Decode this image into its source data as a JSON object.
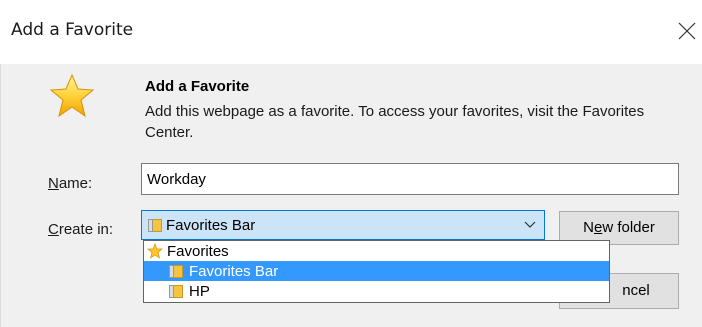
{
  "dialog": {
    "title": "Add a Favorite",
    "heading": "Add a Favorite",
    "description": "Add this webpage as a favorite. To access your favorites, visit the Favorites Center."
  },
  "form": {
    "name_label_u": "N",
    "name_label_rest": "ame:",
    "name_value": "Workday",
    "create_label_u": "C",
    "create_label_rest": "reate in:",
    "create_in_selected": "Favorites Bar"
  },
  "buttons": {
    "new_folder_pre": "N",
    "new_folder_u": "e",
    "new_folder_rest": "w folder",
    "cancel_partial": "ncel"
  },
  "dropdown": {
    "items": [
      {
        "label": "Favorites",
        "icon": "star-icon",
        "selected": false
      },
      {
        "label": "Favorites Bar",
        "icon": "folder-icon",
        "selected": true
      },
      {
        "label": "HP",
        "icon": "folder-icon",
        "selected": false
      }
    ]
  },
  "colors": {
    "accent": "#0078d7",
    "selection": "#3399ff",
    "select_bg": "#cce4f7"
  }
}
